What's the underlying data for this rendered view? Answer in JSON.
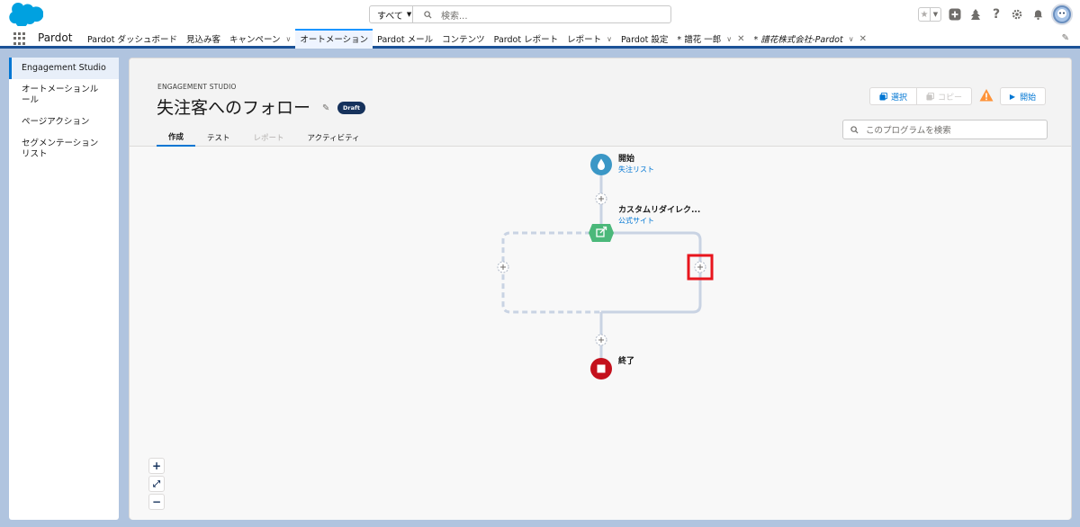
{
  "header": {
    "search_scope": "すべて",
    "search_placeholder": "検索...",
    "icons": [
      "favorites-star-icon",
      "add-icon",
      "trailhead-icon",
      "help-icon",
      "setup-gear-icon",
      "notifications-bell-icon",
      "user-avatar"
    ]
  },
  "nav": {
    "app_name": "Pardot",
    "items": [
      {
        "label": "Pardot ダッシュボード"
      },
      {
        "label": "見込み客"
      },
      {
        "label": "キャンペーン",
        "chevron": true
      },
      {
        "label": "オートメーション",
        "active": true
      },
      {
        "label": "Pardot メール"
      },
      {
        "label": "コンテンツ"
      },
      {
        "label": "Pardot レポート"
      },
      {
        "label": "レポート",
        "chevron": true
      },
      {
        "label": "Pardot 設定"
      },
      {
        "label": "* 譜花 一郎",
        "chevron": true,
        "closable": true
      },
      {
        "label": "* 譜花株式会社-Pardot",
        "chevron": true,
        "closable": true
      }
    ]
  },
  "sidebar": {
    "items": [
      {
        "label": "Engagement Studio",
        "active": true
      },
      {
        "label": "オートメーションルール"
      },
      {
        "label": "ページアクション"
      },
      {
        "label": "セグメンテーションリスト"
      }
    ]
  },
  "page": {
    "eyebrow": "ENGAGEMENT STUDIO",
    "title": "失注客へのフォロー",
    "badge": "Draft",
    "select_label": "選択",
    "copy_label": "コピー",
    "start_label": "開始",
    "program_search_placeholder": "このプログラムを検索",
    "tabs": [
      {
        "label": "作成",
        "active": true
      },
      {
        "label": "テスト"
      },
      {
        "label": "レポート",
        "disabled": true
      },
      {
        "label": "アクティビティ"
      }
    ]
  },
  "flow": {
    "start_title": "開始",
    "start_sub": "失注リスト",
    "trigger_title": "カスタムリダイレク...",
    "trigger_sub": "公式サイト",
    "end_title": "終了",
    "highlight_color": "#e8151d",
    "start_color": "#3b97c6",
    "trigger_color": "#4bb87a",
    "end_color": "#c4101c"
  },
  "zoom": {
    "in": "+",
    "fit": "⤢",
    "out": "−"
  }
}
